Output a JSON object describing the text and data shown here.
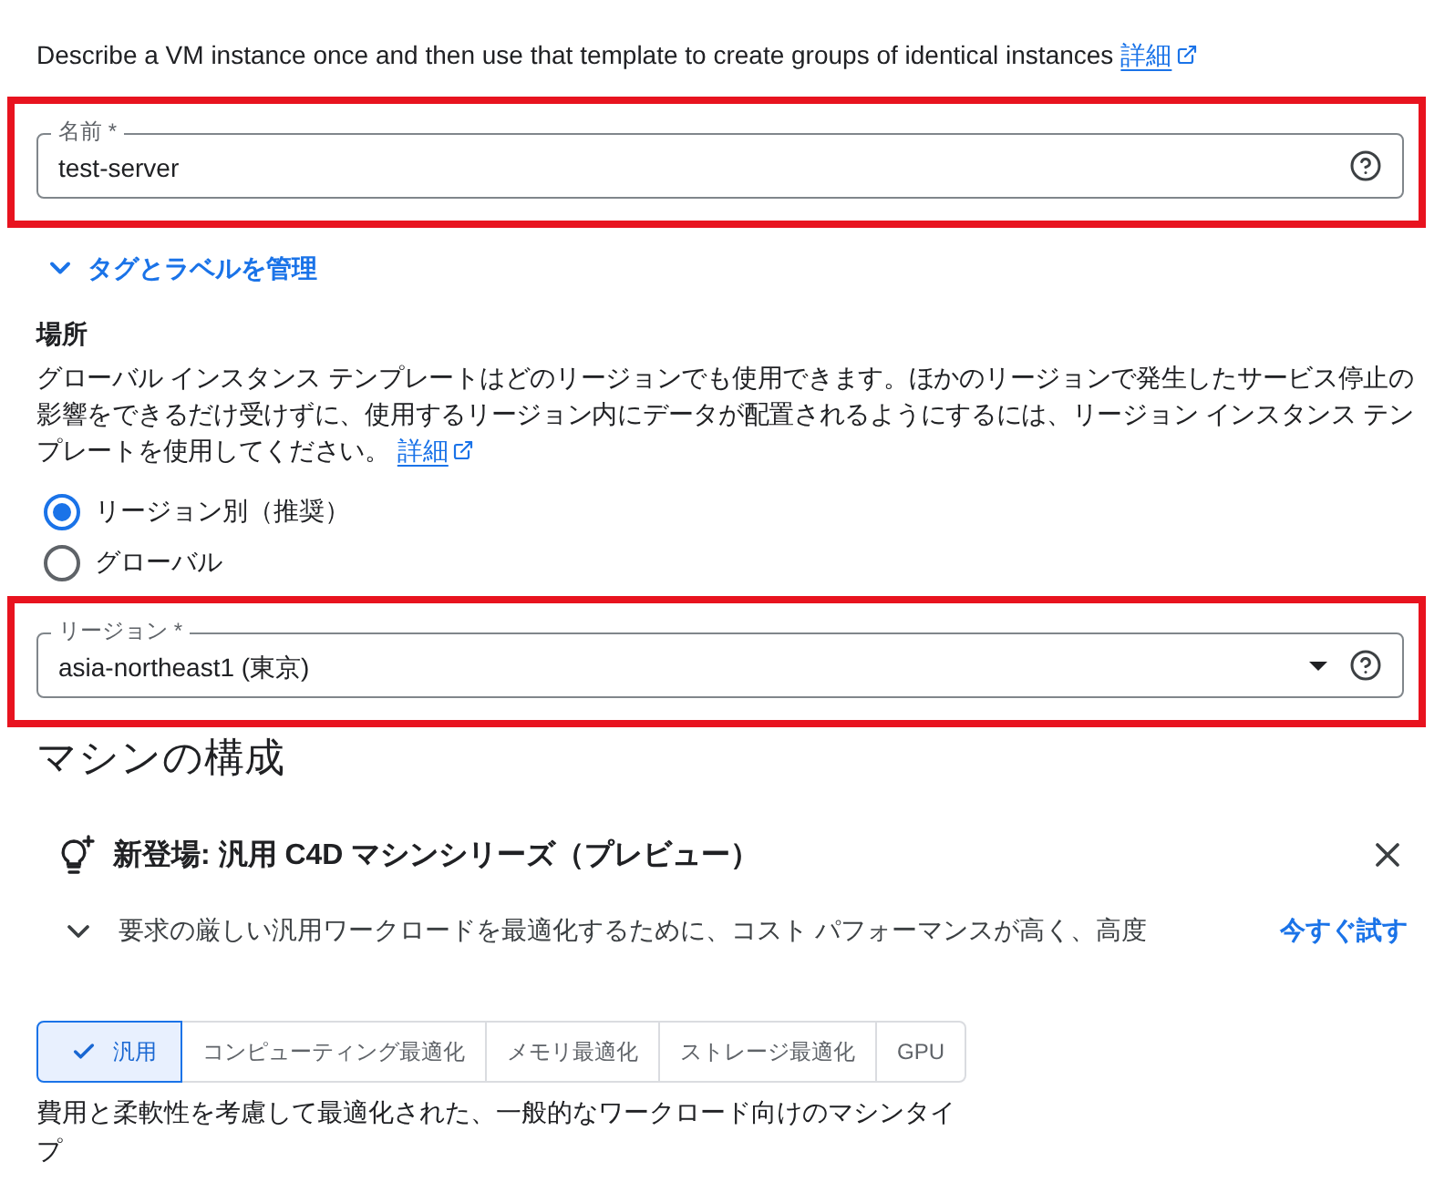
{
  "intro": {
    "text": "Describe a VM instance once and then use that template to create groups of identical instances",
    "link": "詳細"
  },
  "name_field": {
    "label": "名前 *",
    "value": "test-server",
    "highlighted": true
  },
  "tags_toggle": {
    "label": "タグとラベルを管理",
    "expanded": false
  },
  "location": {
    "heading": "場所",
    "description": "グローバル インスタンス テンプレートはどのリージョンでも使用できます。ほかのリージョンで発生したサービス停止の影響をできるだけ受けずに、使用するリージョン内にデータが配置されるようにするには、リージョン インスタンス テンプレートを使用してください。",
    "link": "詳細",
    "options": [
      {
        "label": "リージョン別（推奨）",
        "selected": true
      },
      {
        "label": "グローバル",
        "selected": false
      }
    ]
  },
  "region_field": {
    "label": "リージョン *",
    "value": "asia-northeast1 (東京)",
    "highlighted": true
  },
  "machine_config": {
    "heading": "マシンの構成",
    "banner": {
      "title": "新登場: 汎用 C4D マシンシリーズ（プレビュー）",
      "text": "要求の厳しい汎用ワークロードを最適化するために、コスト パフォーマンスが高く、高度",
      "action": "今すぐ試す",
      "expanded": false
    },
    "families": [
      {
        "label": "汎用",
        "selected": true
      },
      {
        "label": "コンピューティング最適化",
        "selected": false
      },
      {
        "label": "メモリ最適化",
        "selected": false
      },
      {
        "label": "ストレージ最適化",
        "selected": false
      },
      {
        "label": "GPU",
        "selected": false
      }
    ],
    "description": "費用と柔軟性を考慮して最適化された、一般的なワークロード向けのマシンタイプ"
  }
}
